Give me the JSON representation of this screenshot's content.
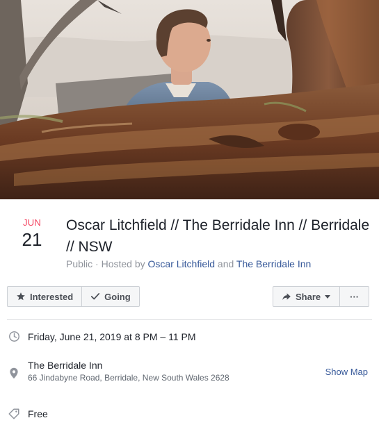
{
  "event": {
    "month": "JUN",
    "day": "21",
    "title": "Oscar Litchfield // The Berridale Inn // Berridale // NSW",
    "privacy": "Public",
    "hosted_by_prefix": "Hosted by",
    "host_1": "Oscar Litchfield",
    "and_text": "and",
    "host_2": "The Berridale Inn"
  },
  "actions": {
    "interested_label": "Interested",
    "going_label": "Going",
    "share_label": "Share",
    "more_label": "···"
  },
  "details": {
    "datetime": "Friday, June 21, 2019 at 8 PM – 11 PM",
    "venue_name": "The Berridale Inn",
    "venue_address": "66 Jindabyne Road, Berridale, New South Wales 2628",
    "show_map_label": "Show Map",
    "price": "Free"
  },
  "icons": {
    "interested": "star-icon",
    "going": "check-icon",
    "share": "share-arrow-icon",
    "share_dropdown": "caret-down-icon",
    "time": "clock-icon",
    "location": "map-pin-icon",
    "price": "price-tag-icon"
  },
  "colors": {
    "month_accent": "#f3425f",
    "link": "#365899",
    "muted": "#90949c"
  }
}
